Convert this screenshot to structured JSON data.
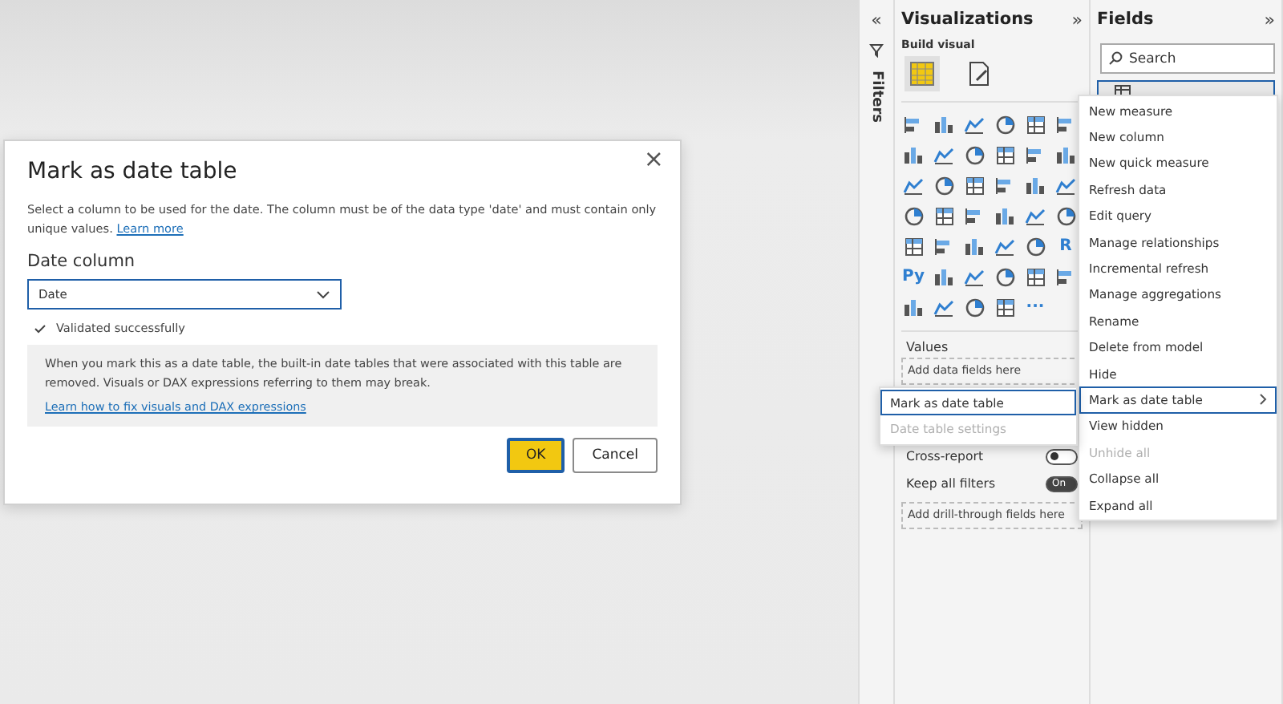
{
  "dialog": {
    "title": "Mark as date table",
    "close": "×",
    "description": "Select a column to be used for the date. The column must be of the data type 'date' and must contain only unique values.",
    "learn_more": "Learn more",
    "date_column_label": "Date column",
    "date_column_value": "Date",
    "validation": "Validated successfully",
    "notice": "When you mark this as a date table, the built-in date tables that were associated with this table are removed. Visuals or DAX expressions referring to them may break.",
    "notice_link": "Learn how to fix visuals and DAX expressions",
    "buttons": [
      {
        "label": "OK",
        "kind": "primary"
      },
      {
        "label": "Cancel",
        "kind": "secondary"
      }
    ]
  },
  "filters": {
    "label": "Filters",
    "expand": "«"
  },
  "visualizations": {
    "title": "Visualizations",
    "collapse": "»",
    "build_label": "Build visual",
    "build_tabs": [
      {
        "kind": "build",
        "selected": true
      },
      {
        "kind": "format",
        "selected": false
      }
    ],
    "visual_types": [
      {
        "kind": "icon"
      },
      {
        "kind": "icon"
      },
      {
        "kind": "icon"
      },
      {
        "kind": "icon"
      },
      {
        "kind": "icon"
      },
      {
        "kind": "icon"
      },
      {
        "kind": "icon"
      },
      {
        "kind": "icon"
      },
      {
        "kind": "icon"
      },
      {
        "kind": "icon"
      },
      {
        "kind": "icon"
      },
      {
        "kind": "icon"
      },
      {
        "kind": "icon"
      },
      {
        "kind": "icon"
      },
      {
        "kind": "icon"
      },
      {
        "kind": "icon"
      },
      {
        "kind": "icon"
      },
      {
        "kind": "icon"
      },
      {
        "kind": "icon"
      },
      {
        "kind": "icon"
      },
      {
        "kind": "icon"
      },
      {
        "kind": "icon"
      },
      {
        "kind": "icon"
      },
      {
        "kind": "icon"
      },
      {
        "kind": "icon"
      },
      {
        "kind": "icon"
      },
      {
        "kind": "icon"
      },
      {
        "kind": "icon"
      },
      {
        "kind": "icon"
      },
      {
        "kind": "text",
        "label": "R"
      },
      {
        "kind": "text",
        "label": "Py"
      },
      {
        "kind": "icon"
      },
      {
        "kind": "icon"
      },
      {
        "kind": "icon"
      },
      {
        "kind": "icon"
      },
      {
        "kind": "icon"
      },
      {
        "kind": "icon"
      },
      {
        "kind": "icon"
      },
      {
        "kind": "icon"
      },
      {
        "kind": "icon"
      },
      {
        "kind": "text",
        "label": "···"
      }
    ],
    "values_label": "Values",
    "values_placeholder": "Add data fields here",
    "cross_report": {
      "label": "Cross-report",
      "on": false
    },
    "keep_filters": {
      "label": "Keep all filters",
      "on": true,
      "state": "On"
    },
    "drill_placeholder": "Add drill-through fields here"
  },
  "fields": {
    "title": "Fields",
    "collapse": "»",
    "search": {
      "placeholder": "Search"
    }
  },
  "context_menu": [
    {
      "label": "New measure",
      "disabled": false,
      "selected": false,
      "submenu": false
    },
    {
      "label": "New column",
      "disabled": false,
      "selected": false,
      "submenu": false
    },
    {
      "label": "New quick measure",
      "disabled": false,
      "selected": false,
      "submenu": false
    },
    {
      "label": "Refresh data",
      "disabled": false,
      "selected": false,
      "submenu": false
    },
    {
      "label": "Edit query",
      "disabled": false,
      "selected": false,
      "submenu": false
    },
    {
      "label": "Manage relationships",
      "disabled": false,
      "selected": false,
      "submenu": false
    },
    {
      "label": "Incremental refresh",
      "disabled": false,
      "selected": false,
      "submenu": false
    },
    {
      "label": "Manage aggregations",
      "disabled": false,
      "selected": false,
      "submenu": false
    },
    {
      "label": "Rename",
      "disabled": false,
      "selected": false,
      "submenu": false
    },
    {
      "label": "Delete from model",
      "disabled": false,
      "selected": false,
      "submenu": false
    },
    {
      "label": "Hide",
      "disabled": false,
      "selected": false,
      "submenu": false
    },
    {
      "label": "Mark as date table",
      "disabled": false,
      "selected": true,
      "submenu": true
    },
    {
      "label": "View hidden",
      "disabled": false,
      "selected": false,
      "submenu": false
    },
    {
      "label": "Unhide all",
      "disabled": true,
      "selected": false,
      "submenu": false
    },
    {
      "label": "Collapse all",
      "disabled": false,
      "selected": false,
      "submenu": false
    },
    {
      "label": "Expand all",
      "disabled": false,
      "selected": false,
      "submenu": false
    }
  ],
  "submenu": [
    {
      "label": "Mark as date table",
      "disabled": false,
      "selected": true
    },
    {
      "label": "Date table settings",
      "disabled": true,
      "selected": false
    }
  ]
}
